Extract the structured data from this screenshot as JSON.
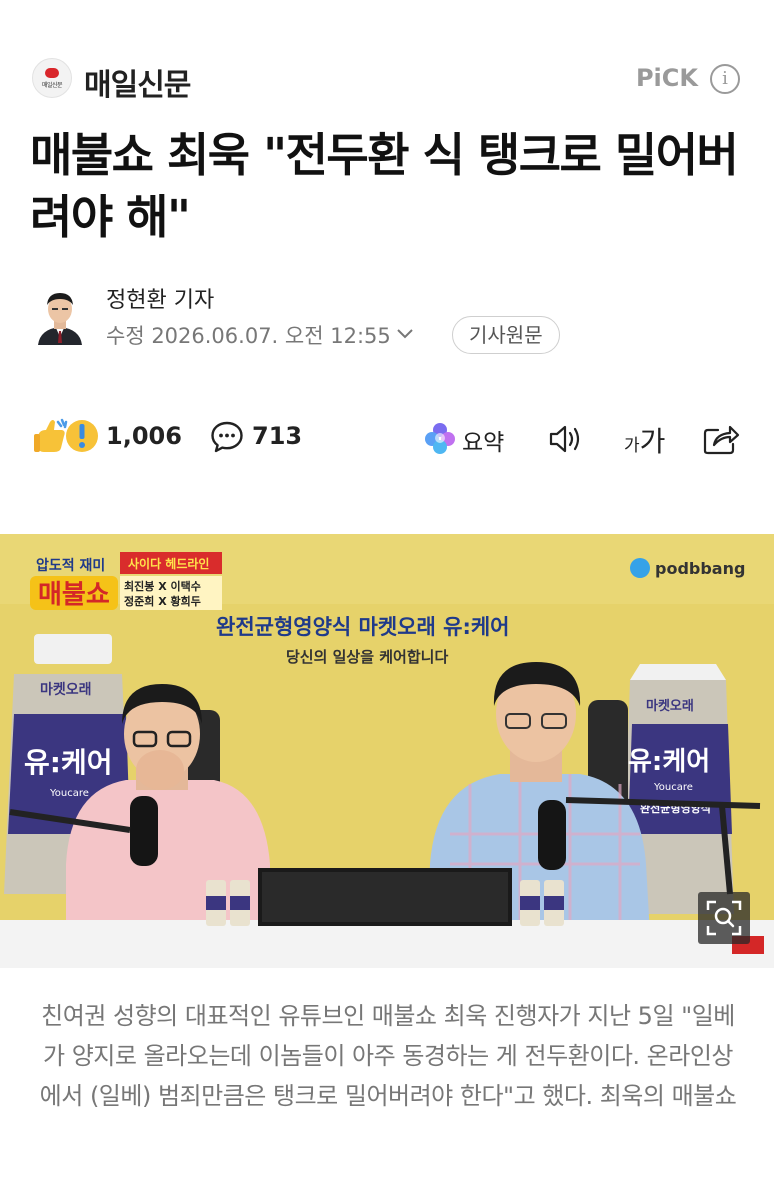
{
  "header": {
    "brand_name": "매일신문",
    "brand_logo_text": "매일신문",
    "pick_label": "PiCK"
  },
  "article": {
    "headline": "매불쇼 최욱 \"전두환 식 탱크로 밀어버려야 해\"",
    "author": "정현환 기자",
    "date": "수정 2026.06.07. 오전 12:55",
    "original_button": "기사원문"
  },
  "actions": {
    "reaction_count": "1,006",
    "comment_count": "713",
    "summary_label": "요약",
    "font_small": "가",
    "font_large": "가"
  },
  "photo": {
    "show_badge_top": "압도적 재미",
    "show_title": "매불쇼",
    "segment_title": "사이다 헤드라인",
    "cast_line1": "최진봉 X 이택수",
    "cast_line2": "정준희 X 황희두",
    "banner_line1": "완전균형영양식  마켓오래 유:케어",
    "banner_line2": "당신의 일상을 케어합니다",
    "podcast_brand": "podbbang",
    "product_brand": "마켓오래",
    "product_name": "유:케어",
    "product_sub": "Youcare",
    "product_desc": "완전균형영양식"
  },
  "caption": "친여권 성향의 대표적인 유튜브인 매불쇼 최욱 진행자가 지난 5일 \"일베가 양지로 올라오는데 이놈들이 아주 동경하는 게 전두환이다. 온라인상에서 (일베) 범죄만큼은 탱크로 밀어버려야 한다\"고 했다. 최욱의 매불쇼",
  "colors": {
    "brand_red": "#d9262b",
    "photo_bg": "#e7d36a",
    "text_gray": "#777777"
  }
}
